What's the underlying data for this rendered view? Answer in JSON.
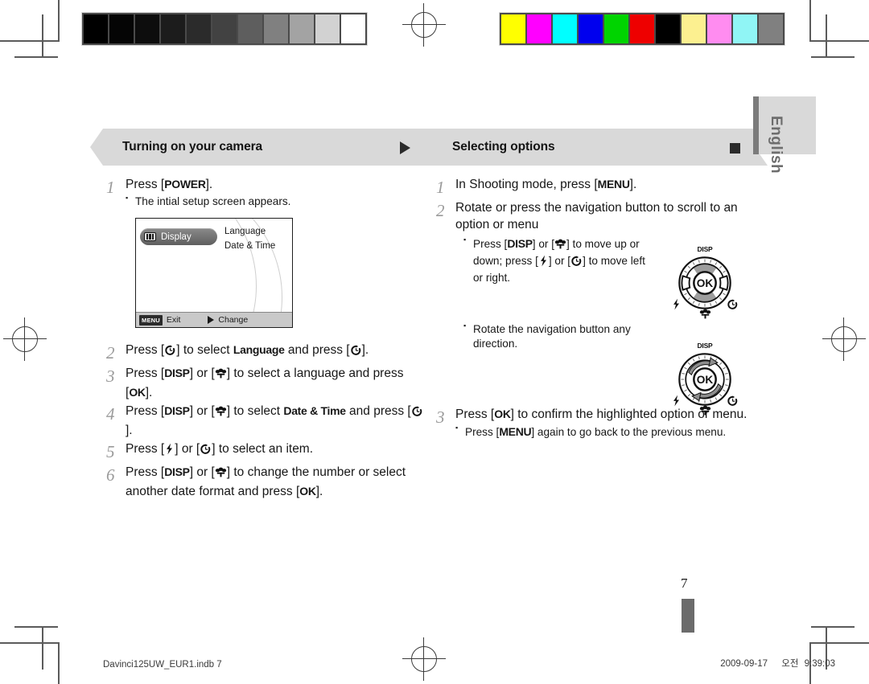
{
  "document": {
    "language_tab": "English",
    "page_number": "7",
    "footer_left": "Davinci125UW_EUR1.indb   7",
    "footer_date": "2009-09-17",
    "footer_time_ampm": "오전",
    "footer_time": "9:39:03"
  },
  "calibration": {
    "grayscale_label": "grayscale-calibration-strip",
    "grayscale_swatches": [
      "#000000",
      "#050505",
      "#0d0d0d",
      "#1c1c1c",
      "#2b2b2b",
      "#424242",
      "#5e5e5e",
      "#808080",
      "#a3a3a3",
      "#d2d2d2",
      "#ffffff"
    ],
    "color_label": "color-calibration-strip",
    "color_swatches": [
      "#ffff00",
      "#ff00ff",
      "#00ffff",
      "#0000ee",
      "#00d400",
      "#ee0000",
      "#000000",
      "#fcf090",
      "#ff8cf0",
      "#90f5f5",
      "#808080"
    ]
  },
  "left_column": {
    "heading": "Turning on your camera",
    "head_mark": "triangle-right",
    "steps": [
      {
        "num": "1",
        "text_parts": [
          {
            "t": "Press [",
            "b": false
          },
          {
            "t": "POWER",
            "b": true
          },
          {
            "t": "].",
            "b": false
          }
        ],
        "bullets": [
          "The intial setup screen appears."
        ]
      },
      {
        "num": "2",
        "text_parts": [
          {
            "t": "Press [",
            "b": false
          },
          {
            "t": "ICON:timer",
            "b": false
          },
          {
            "t": "] to select ",
            "b": false
          },
          {
            "t": "Language",
            "b": true
          },
          {
            "t": " and press [",
            "b": false
          },
          {
            "t": "ICON:timer",
            "b": false
          },
          {
            "t": "].",
            "b": false
          }
        ],
        "bullets": []
      },
      {
        "num": "3",
        "text_parts": [
          {
            "t": "Press [",
            "b": false
          },
          {
            "t": "DISP",
            "b": true
          },
          {
            "t": "] or [",
            "b": false
          },
          {
            "t": "ICON:macro",
            "b": false
          },
          {
            "t": "] to select a language and press [",
            "b": false
          },
          {
            "t": "OK",
            "b": true
          },
          {
            "t": "].",
            "b": false
          }
        ],
        "bullets": []
      },
      {
        "num": "4",
        "text_parts": [
          {
            "t": "Press [",
            "b": false
          },
          {
            "t": "DISP",
            "b": true
          },
          {
            "t": "] or [",
            "b": false
          },
          {
            "t": "ICON:macro",
            "b": false
          },
          {
            "t": "] to select ",
            "b": false
          },
          {
            "t": "Date & Time",
            "b": true
          },
          {
            "t": " and press [",
            "b": false
          },
          {
            "t": "ICON:timer",
            "b": false
          },
          {
            "t": "].",
            "b": false
          }
        ],
        "bullets": []
      },
      {
        "num": "5",
        "text_parts": [
          {
            "t": "Press [",
            "b": false
          },
          {
            "t": "ICON:flash",
            "b": false
          },
          {
            "t": "] or [",
            "b": false
          },
          {
            "t": "ICON:timer",
            "b": false
          },
          {
            "t": "] to select an item.",
            "b": false
          }
        ],
        "bullets": []
      },
      {
        "num": "6",
        "text_parts": [
          {
            "t": "Press [",
            "b": false
          },
          {
            "t": "DISP",
            "b": true
          },
          {
            "t": "] or [",
            "b": false
          },
          {
            "t": "ICON:macro",
            "b": false
          },
          {
            "t": "] to change the number or select another date format and press [",
            "b": false
          },
          {
            "t": "OK",
            "b": true
          },
          {
            "t": "].",
            "b": false
          }
        ],
        "bullets": []
      }
    ]
  },
  "lcd_screen": {
    "selected_item": "Display",
    "options": [
      "Language",
      "Date & Time"
    ],
    "bottom_menu_key": "MENU",
    "bottom_exit_label": "Exit",
    "bottom_change_label": "Change"
  },
  "right_column": {
    "heading": "Selecting options",
    "head_mark": "square",
    "steps": [
      {
        "num": "1",
        "text_parts": [
          {
            "t": "In Shooting mode, press [",
            "b": false
          },
          {
            "t": "MENU",
            "b": true
          },
          {
            "t": "].",
            "b": false
          }
        ],
        "bullets": []
      },
      {
        "num": "2",
        "text_parts": [
          {
            "t": "Rotate or press the navigation button to scroll to an option or menu",
            "b": false
          }
        ],
        "bullets": []
      }
    ],
    "bullet_group_1": [
      {
        "t": "Press [",
        "b": false
      },
      {
        "t": "DISP",
        "b": true
      },
      {
        "t": "] or [",
        "b": false
      },
      {
        "t": "ICON:macro",
        "b": false
      },
      {
        "t": "] to move up or down; press [",
        "b": false
      },
      {
        "t": "ICON:flash",
        "b": false
      },
      {
        "t": "] or [",
        "b": false
      },
      {
        "t": "ICON:timer",
        "b": false
      },
      {
        "t": "] to move left or right.",
        "b": false
      }
    ],
    "bullet_group_2": "Rotate the navigation button any direction.",
    "step3": {
      "num": "3",
      "text_parts": [
        {
          "t": "Press [",
          "b": false
        },
        {
          "t": "OK",
          "b": true
        },
        {
          "t": "] to confirm the highlighted option or menu.",
          "b": false
        }
      ],
      "bullets_parts": [
        {
          "t": "Press [",
          "b": false
        },
        {
          "t": "MENU",
          "b": true
        },
        {
          "t": "] again to go back to the previous menu.",
          "b": false
        }
      ]
    }
  },
  "nav_wheel": {
    "top_label": "DISP",
    "center_label": "OK",
    "left_icon": "flash-icon",
    "right_icon": "timer-icon",
    "bottom_icon": "macro-icon"
  },
  "colors": {
    "header_bg": "#d9d9d9",
    "step_number": "#9a9a9a",
    "text": "#171717",
    "tab_gray": "#6d6d6d"
  }
}
